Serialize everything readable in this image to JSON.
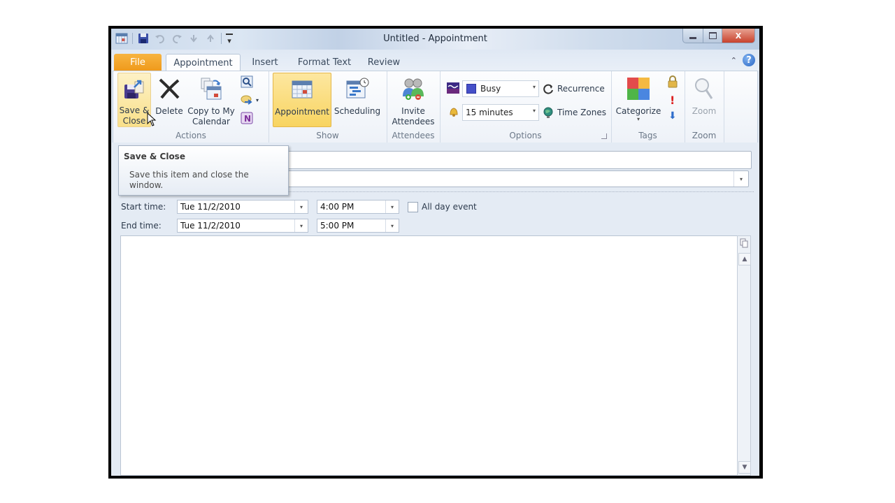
{
  "window": {
    "title": "Untitled  -  Appointment",
    "controls": {
      "minimize": "—",
      "maximize": "▢",
      "close": "X"
    }
  },
  "quick_access": {
    "items": [
      "calendar-icon",
      "save-icon",
      "undo-icon",
      "redo-icon",
      "previous-item-icon",
      "next-item-icon",
      "customize-toolbar-icon"
    ],
    "customize_glyph": "▾"
  },
  "tabs": {
    "file": "File",
    "appointment": "Appointment",
    "insert": "Insert",
    "format_text": "Format Text",
    "review": "Review",
    "minimize_ribbon_glyph": "⌃",
    "help_glyph": "?"
  },
  "ribbon": {
    "actions": {
      "label": "Actions",
      "save_close": "Save &\nClose",
      "save_close_l1": "Save &",
      "save_close_l2": "Close",
      "delete": "Delete",
      "copy_l1": "Copy to My",
      "copy_l2": "Calendar"
    },
    "show": {
      "label": "Show",
      "appointment": "Appointment",
      "scheduling": "Scheduling"
    },
    "attendees": {
      "label": "Attendees",
      "invite_l1": "Invite",
      "invite_l2": "Attendees"
    },
    "options": {
      "label": "Options",
      "show_as": "Busy",
      "reminder": "15 minutes",
      "recurrence": "Recurrence",
      "time_zones": "Time Zones",
      "dropdown_glyph": "▾"
    },
    "tags": {
      "label": "Tags",
      "categorize": "Categorize",
      "categorize_arrow": "▾",
      "high_importance": "!",
      "low_importance": "⬇",
      "category_colors": [
        "#e24b4b",
        "#f4b942",
        "#4fb548",
        "#4a86e0"
      ]
    },
    "zoom": {
      "label": "Zoom",
      "zoom": "Zoom"
    }
  },
  "tooltip": {
    "title": "Save & Close",
    "body": "Save this item and close the window."
  },
  "form": {
    "subject_value": "",
    "location_value": "",
    "start_label": "Start time:",
    "start_date": "Tue 11/2/2010",
    "start_time": "4:00 PM",
    "end_label": "End time:",
    "end_date": "Tue 11/2/2010",
    "end_time": "5:00 PM",
    "all_day_label": "All day event",
    "all_day_checked": false,
    "dropdown_glyph": "▾",
    "body_text": ""
  },
  "scrollbar": {
    "up_glyph": "▲",
    "down_glyph": "▼"
  }
}
